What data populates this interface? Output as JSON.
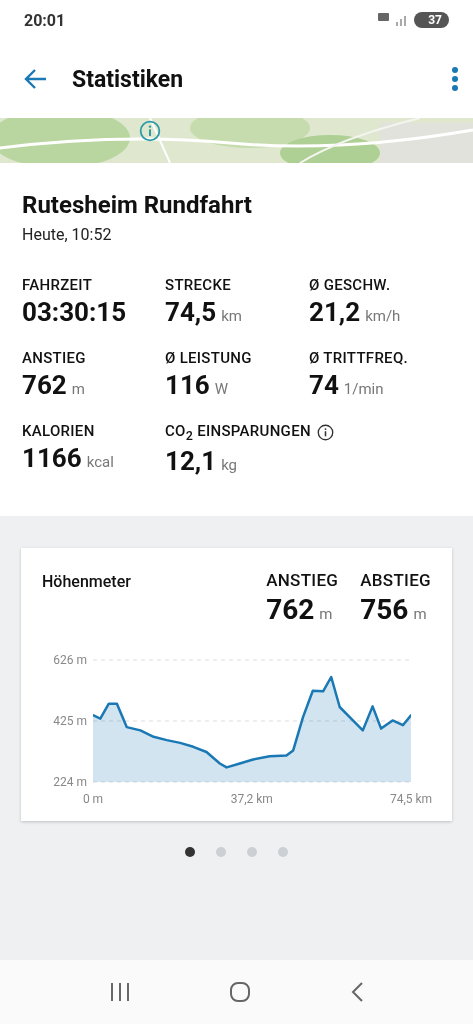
{
  "status_bar": {
    "time": "20:01",
    "battery": "37"
  },
  "app_bar": {
    "title": "Statistiken"
  },
  "ride": {
    "title": "Rutesheim Rundfahrt",
    "date": "Heute, 10:52"
  },
  "stats": [
    {
      "label": "FAHRZEIT",
      "value": "03:30:15",
      "info": false
    },
    {
      "label": "STRECKE",
      "value": "74,5",
      "unit": "km",
      "info": false
    },
    {
      "label": "Ø GESCHW.",
      "value": "21,2",
      "unit": "km/h",
      "info": false
    },
    {
      "label": "ANSTIEG",
      "value": "762",
      "unit": "m",
      "info": false
    },
    {
      "label": "Ø LEISTUNG",
      "value": "116",
      "unit": "W",
      "info": false
    },
    {
      "label": "Ø TRITTFREQ.",
      "value": "74",
      "unit": "1/min",
      "info": false
    },
    {
      "label": "KALORIEN",
      "value": "1166",
      "unit": "kcal",
      "info": false
    },
    {
      "label": "CO$_{2}$ EINSPARUNGEN",
      "value": "12,1",
      "unit": "kg",
      "info": true
    }
  ],
  "elevation": {
    "title": "Höhenmeter",
    "summary": [
      {
        "label": "ANSTIEG",
        "value": "762",
        "unit": "m"
      },
      {
        "label": "ABSTIEG",
        "value": "756",
        "unit": "m"
      }
    ],
    "chart_data": {
      "type": "area",
      "xlim": [
        0,
        74.5
      ],
      "ylim": [
        224,
        626
      ],
      "x": [
        0,
        1.7,
        3.7,
        5.6,
        7.9,
        11.1,
        14.2,
        17.3,
        20.4,
        23.5,
        26.6,
        29.7,
        31.3,
        34.4,
        37.5,
        41.4,
        45.3,
        46.9,
        49.2,
        51.5,
        53.9,
        55.8,
        57.8,
        60.9,
        63.2,
        65.5,
        67.5,
        70.2,
        72.6,
        74.5
      ],
      "series": [
        {
          "color": "#1a78b4",
          "values": [
            444,
            433,
            482,
            482,
            405,
            394,
            373,
            362,
            353,
            340,
            323,
            285,
            272,
            285,
            298,
            309,
            311,
            328,
            438,
            525,
            523,
            570,
            471,
            427,
            394,
            473,
            400,
            427,
            411,
            444
          ]
        }
      ],
      "yticks": [
        {
          "value": 224,
          "label": "224 m"
        },
        {
          "value": 425,
          "label": "425 m"
        },
        {
          "value": 626,
          "label": "626 m"
        }
      ],
      "xticks": [
        {
          "value": 0,
          "label": "0 m"
        },
        {
          "value": 37.2,
          "label": "37,2 km"
        },
        {
          "value": 74.5,
          "label": "74,5 km"
        }
      ]
    }
  },
  "pager": [
    {
      "selected": true
    },
    {
      "selected": false
    },
    {
      "selected": false
    },
    {
      "selected": false
    }
  ]
}
